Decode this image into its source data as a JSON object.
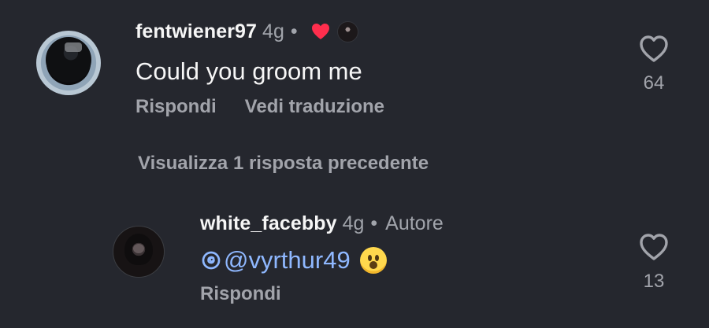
{
  "comments": [
    {
      "username": "fentwiener97",
      "time": "4g",
      "dot": "•",
      "text": "Could you groom me",
      "actions": [
        "Rispondi",
        "Vedi traduzione"
      ],
      "likes": "64"
    },
    {
      "username": "white_facebby",
      "time": "4g",
      "dot": "•",
      "author": "Autore",
      "mention": "@vyrthur49",
      "actions": [
        "Rispondi"
      ],
      "likes": "13"
    }
  ],
  "view_previous": "Visualizza 1 risposta precedente",
  "colors": {
    "background": "#25272e",
    "text_primary": "#f6f6f6",
    "text_secondary": "#a2a4ab",
    "mention": "#8fb8ff",
    "liked_heart": "#ff2e4d"
  },
  "icons": {
    "like": "heart-outline-icon",
    "liked": "filled-heart-icon",
    "mention": "threads-icon",
    "reaction": "surprised-face-icon"
  }
}
